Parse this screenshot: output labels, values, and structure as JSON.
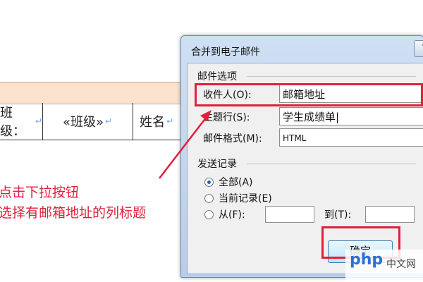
{
  "document": {
    "cells": [
      "班级：",
      "«班级»",
      "姓名"
    ],
    "para_mark": "↵"
  },
  "annotation": {
    "line1": "点击下拉按钮",
    "line2": "选择有邮箱地址的列标题",
    "color": "#e0203c"
  },
  "dialog": {
    "title": "合并到电子邮件",
    "help_button": "?",
    "mail_options": {
      "legend": "邮件选项",
      "recipient_label": "收件人(O):",
      "recipient_value": "邮箱地址",
      "subject_label": "主题行(S):",
      "subject_value": "学生成绩单|",
      "format_label": "邮件格式(M):",
      "format_value": "HTML"
    },
    "send_records": {
      "legend": "发送记录",
      "all_label": "全部(A)",
      "current_label": "当前记录(E)",
      "from_label": "从(F):",
      "to_label": "到(T):",
      "from_value": "",
      "to_value": "",
      "selected": "all"
    },
    "ok_button": "确定"
  },
  "watermark": {
    "brand": "php",
    "site": "中文网"
  }
}
